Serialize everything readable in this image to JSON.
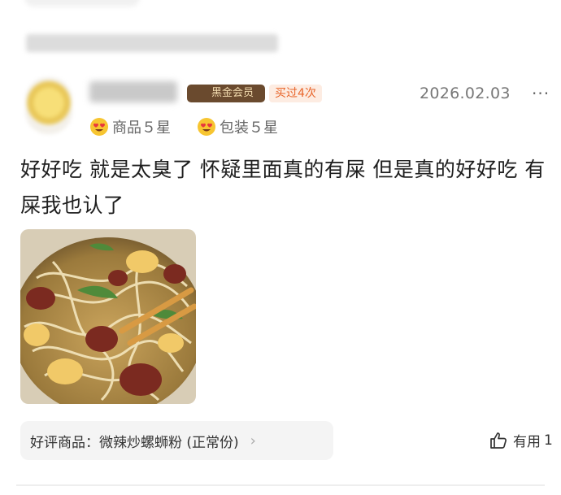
{
  "review": {
    "member_badge": "黑金会员",
    "purchase_count": "买过4次",
    "date": "2026.02.03",
    "more_label": "···",
    "ratings": [
      {
        "label": "商品５星"
      },
      {
        "label": "包装５星"
      }
    ],
    "text": "好好吃 就是太臭了 怀疑里面真的有屎 但是真的好好吃 有屎我也认了",
    "product": {
      "label": "好评商品：",
      "name": "微辣炒螺蛳粉 (正常份)",
      "chevron": "›"
    },
    "useful": {
      "label": "有用",
      "count": "1"
    }
  },
  "icons": {
    "rating": "heart-eyes-emoji-icon",
    "badge": "black-gold-member-icon",
    "useful": "thumbs-up-icon",
    "more": "more-dots-icon"
  },
  "colors": {
    "badge_bg": "#6a4a2e",
    "badge_text": "#f4ddb0",
    "bought_text": "#e8652a",
    "bought_bg": "#fdece2"
  }
}
